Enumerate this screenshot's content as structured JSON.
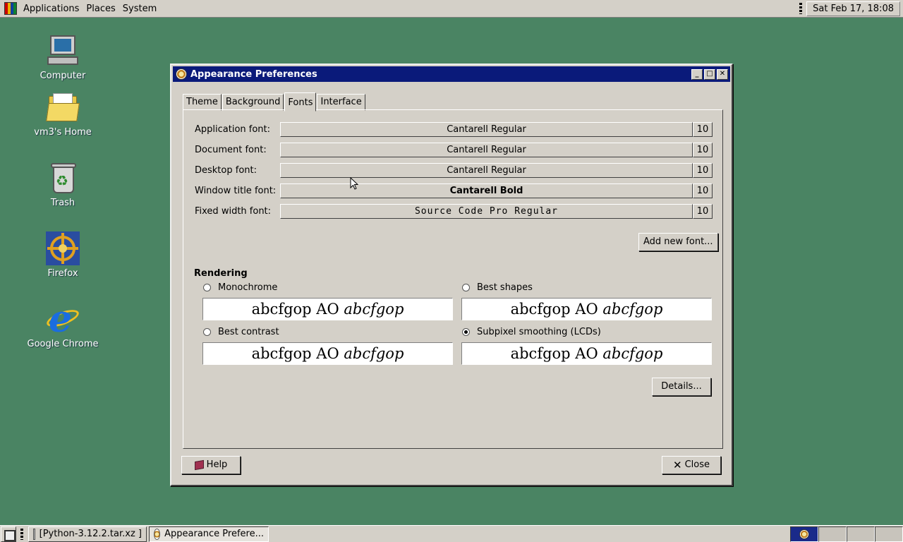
{
  "top_panel": {
    "menus": [
      "Applications",
      "Places",
      "System"
    ],
    "clock": "Sat Feb 17, 18:08"
  },
  "desktop": {
    "icons": [
      {
        "label": "Computer",
        "icon": "computer-icon"
      },
      {
        "label": "vm3's Home",
        "icon": "home-folder-icon"
      },
      {
        "label": "Trash",
        "icon": "trash-icon"
      },
      {
        "label": "Firefox",
        "icon": "firefox-icon"
      },
      {
        "label": "Google Chrome",
        "icon": "chrome-icon"
      }
    ]
  },
  "window": {
    "title": "Appearance Preferences",
    "tabs": [
      "Theme",
      "Background",
      "Fonts",
      "Interface"
    ],
    "active_tab": "Fonts",
    "fonts": [
      {
        "label": "Application font:",
        "value": "Cantarell Regular",
        "size": "10"
      },
      {
        "label": "Document font:",
        "value": "Cantarell Regular",
        "size": "10"
      },
      {
        "label": "Desktop font:",
        "value": "Cantarell Regular",
        "size": "10"
      },
      {
        "label": "Window title font:",
        "value": "Cantarell Bold",
        "size": "10"
      },
      {
        "label": "Fixed width font:",
        "value": "Source Code Pro Regular",
        "size": "10"
      }
    ],
    "add_font_label": "Add new font...",
    "rendering": {
      "title": "Rendering",
      "options": [
        {
          "label": "Monochrome",
          "checked": false
        },
        {
          "label": "Best shapes",
          "checked": false
        },
        {
          "label": "Best contrast",
          "checked": false
        },
        {
          "label": "Subpixel smoothing (LCDs)",
          "checked": true
        }
      ],
      "preview_regular": "abcfgop AO ",
      "preview_italic": "abcfgop"
    },
    "details_label": "Details...",
    "help_label": "Help",
    "close_label": "Close"
  },
  "taskbar": {
    "tasks": [
      {
        "label": "[Python-3.12.2.tar.xz ]",
        "active": false
      },
      {
        "label": "Appearance Prefere...",
        "active": true
      }
    ]
  }
}
